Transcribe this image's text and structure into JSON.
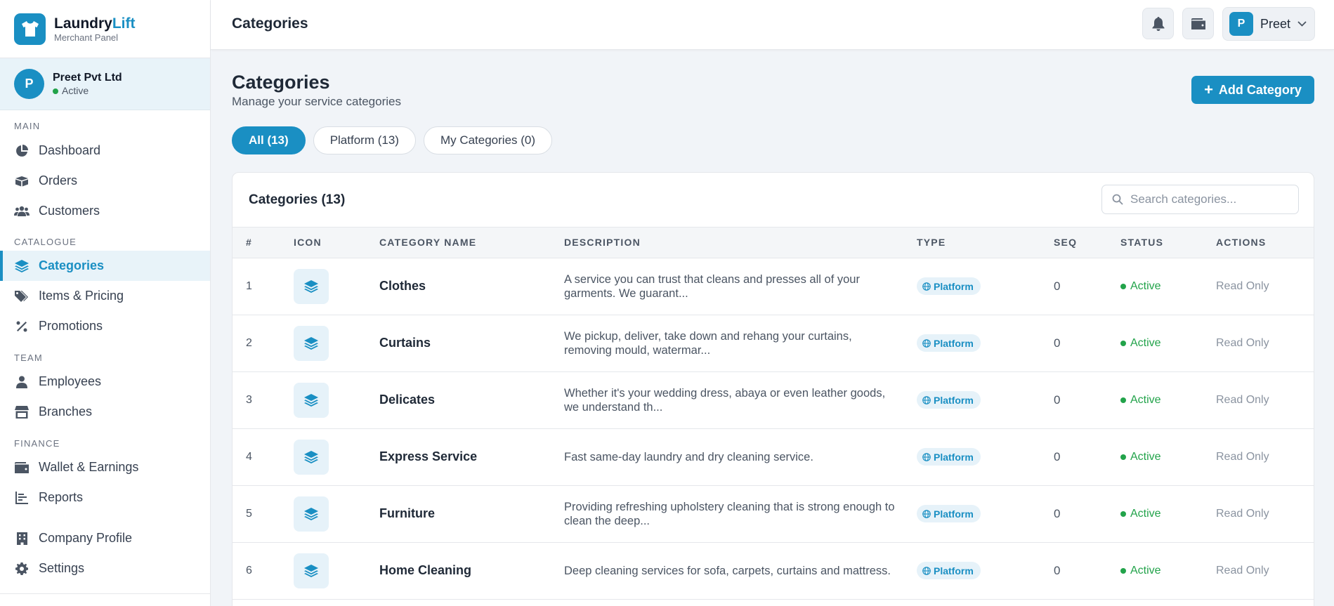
{
  "brand": {
    "name_primary": "Laundry",
    "name_accent": "Lift",
    "subtitle": "Merchant Panel"
  },
  "merchant": {
    "initial": "P",
    "name": "Preet Pvt Ltd",
    "status": "Active"
  },
  "nav": {
    "main_label": "MAIN",
    "main": [
      {
        "label": "Dashboard",
        "icon": "pie-chart-icon"
      },
      {
        "label": "Orders",
        "icon": "box-icon"
      },
      {
        "label": "Customers",
        "icon": "users-icon"
      }
    ],
    "catalogue_label": "CATALOGUE",
    "catalogue": [
      {
        "label": "Categories",
        "icon": "layers-icon",
        "active": true
      },
      {
        "label": "Items & Pricing",
        "icon": "tags-icon"
      },
      {
        "label": "Promotions",
        "icon": "percent-icon"
      }
    ],
    "team_label": "TEAM",
    "team": [
      {
        "label": "Employees",
        "icon": "user-icon"
      },
      {
        "label": "Branches",
        "icon": "store-icon"
      }
    ],
    "finance_label": "FINANCE",
    "finance": [
      {
        "label": "Wallet & Earnings",
        "icon": "wallet-icon"
      },
      {
        "label": "Reports",
        "icon": "bar-chart-icon"
      }
    ],
    "bottom": [
      {
        "label": "Company Profile",
        "icon": "building-icon"
      },
      {
        "label": "Settings",
        "icon": "gear-icon"
      }
    ]
  },
  "topbar": {
    "title": "Categories",
    "user_initial": "P",
    "user_name": "Preet"
  },
  "page": {
    "title": "Categories",
    "subtitle": "Manage your service categories",
    "add_button": "Add Category"
  },
  "filters": [
    {
      "label": "All (13)",
      "active": true
    },
    {
      "label": "Platform (13)",
      "active": false
    },
    {
      "label": "My Categories (0)",
      "active": false
    }
  ],
  "table": {
    "title": "Categories (13)",
    "search_placeholder": "Search categories...",
    "columns": [
      "#",
      "ICON",
      "CATEGORY NAME",
      "DESCRIPTION",
      "TYPE",
      "SEQ",
      "STATUS",
      "ACTIONS"
    ],
    "rows": [
      {
        "num": "1",
        "name": "Clothes",
        "description": "A service you can trust that cleans and presses all of your garments. We guarant...",
        "type": "Platform",
        "seq": "0",
        "status": "Active",
        "action": "Read Only"
      },
      {
        "num": "2",
        "name": "Curtains",
        "description": "We pickup, deliver, take down and rehang your curtains, removing mould, watermar...",
        "type": "Platform",
        "seq": "0",
        "status": "Active",
        "action": "Read Only"
      },
      {
        "num": "3",
        "name": "Delicates",
        "description": "Whether it's your wedding dress, abaya or even leather goods, we understand th...",
        "type": "Platform",
        "seq": "0",
        "status": "Active",
        "action": "Read Only"
      },
      {
        "num": "4",
        "name": "Express Service",
        "description": "Fast same-day laundry and dry cleaning service.",
        "type": "Platform",
        "seq": "0",
        "status": "Active",
        "action": "Read Only"
      },
      {
        "num": "5",
        "name": "Furniture",
        "description": "Providing refreshing upholstery cleaning that is strong enough to clean the deep...",
        "type": "Platform",
        "seq": "0",
        "status": "Active",
        "action": "Read Only"
      },
      {
        "num": "6",
        "name": "Home Cleaning",
        "description": "Deep cleaning services for sofa, carpets, curtains and mattress.",
        "type": "Platform",
        "seq": "0",
        "status": "Active",
        "action": "Read Only"
      }
    ]
  },
  "colors": {
    "accent": "#1a8fc3",
    "success": "#22a34a",
    "background": "#f1f4f8"
  }
}
